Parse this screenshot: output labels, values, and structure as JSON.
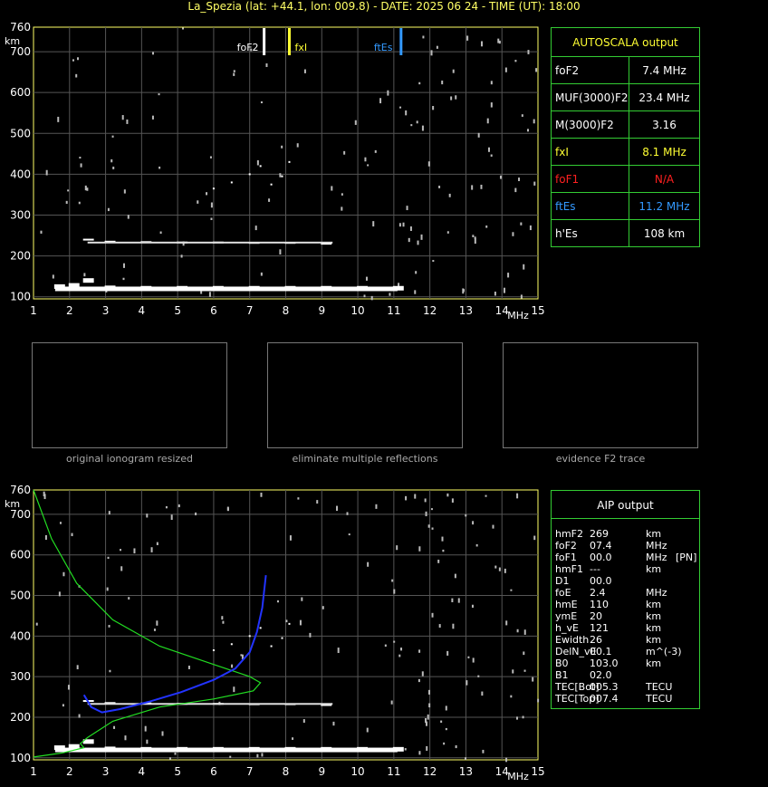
{
  "header": {
    "title": "La_Spezia (lat: +44.1, lon: 009.8) - DATE: 2025 06 24 - TIME (UT): 18:00"
  },
  "axes": {
    "y_unit": "km",
    "x_unit": "MHz",
    "x_ticks": [
      "1",
      "2",
      "3",
      "4",
      "5",
      "6",
      "7",
      "8",
      "9",
      "10",
      "11",
      "12",
      "13",
      "14",
      "15"
    ],
    "y_ticks": [
      "100",
      "200",
      "300",
      "400",
      "500",
      "600",
      "700",
      "760"
    ]
  },
  "markers": {
    "foF2": "foF2",
    "fxI": "fxI",
    "ftEs": "ftEs"
  },
  "autoscala": {
    "title": "AUTOSCALA output",
    "rows": [
      {
        "key": "foF2",
        "value": "7.4 MHz",
        "color": "#ffffff"
      },
      {
        "key": "MUF(3000)F2",
        "value": "23.4 MHz",
        "color": "#ffffff"
      },
      {
        "key": "M(3000)F2",
        "value": "3.16",
        "color": "#ffffff"
      },
      {
        "key": "fxI",
        "value": "8.1 MHz",
        "color": "#ffff33"
      },
      {
        "key": "foF1",
        "value": "N/A",
        "color": "#ff2020"
      },
      {
        "key": "ftEs",
        "value": "11.2 MHz",
        "color": "#3399ff"
      },
      {
        "key": "h'Es",
        "value": "108     km",
        "color": "#ffffff"
      }
    ]
  },
  "thumbs": {
    "captions": [
      "original ionogram resized",
      "eliminate multiple reflections",
      "evidence F2 trace"
    ]
  },
  "aip": {
    "title": "AIP output",
    "rows": [
      {
        "k": "hmF2",
        "v": "269",
        "u": "km",
        "x": ""
      },
      {
        "k": "foF2",
        "v": "07.4",
        "u": "MHz",
        "x": ""
      },
      {
        "k": "foF1",
        "v": "00.0",
        "u": "MHz",
        "x": "[PN]"
      },
      {
        "k": "hmF1",
        "v": "---",
        "u": "km",
        "x": ""
      },
      {
        "k": "D1",
        "v": "00.0",
        "u": "",
        "x": ""
      },
      {
        "k": "foE",
        "v": "2.4",
        "u": "MHz",
        "x": ""
      },
      {
        "k": "hmE",
        "v": "110",
        "u": "km",
        "x": ""
      },
      {
        "k": "ymE",
        "v": "20",
        "u": "km",
        "x": ""
      },
      {
        "k": "h_vE",
        "v": "121",
        "u": "km",
        "x": ""
      },
      {
        "k": "Ewidth",
        "v": "26",
        "u": "km",
        "x": ""
      },
      {
        "k": "DelN_vE",
        "v": "00.1",
        "u": "m^(-3)",
        "x": ""
      },
      {
        "k": "B0",
        "v": "103.0",
        "u": "km",
        "x": ""
      },
      {
        "k": "B1",
        "v": "02.0",
        "u": "",
        "x": ""
      },
      {
        "k": "TEC[Bot]",
        "v": "005.3",
        "u": "TECU",
        "x": ""
      },
      {
        "k": "TEC[Top]",
        "v": "007.4",
        "u": "TECU",
        "x": ""
      }
    ]
  },
  "chart_data": [
    {
      "type": "scatter",
      "xlabel": "MHz",
      "ylabel": "km",
      "xlim": [
        1,
        15
      ],
      "ylim": [
        95,
        760
      ],
      "series": [
        {
          "values": [
            [
              1.6,
              125
            ],
            [
              2.0,
              128
            ],
            [
              2.4,
              140
            ],
            [
              3,
              122
            ],
            [
              4,
              121
            ],
            [
              5,
              121
            ],
            [
              6,
              121
            ],
            [
              7,
              121
            ],
            [
              8,
              121
            ],
            [
              9,
              121
            ],
            [
              10,
              121
            ],
            [
              11,
              121
            ]
          ]
        },
        {
          "values": [
            [
              2.4,
              240
            ],
            [
              3,
              235
            ],
            [
              4,
              234
            ],
            [
              5,
              233
            ],
            [
              6,
              233
            ],
            [
              7,
              232
            ],
            [
              8,
              232
            ],
            [
              9,
              230
            ]
          ]
        },
        {
          "values": [
            [
              6.0,
              365
            ],
            [
              6.5,
              380
            ],
            [
              7.0,
              400
            ],
            [
              7.3,
              420
            ],
            [
              7.6,
              375
            ],
            [
              7.9,
              395
            ],
            [
              8.1,
              430
            ]
          ]
        }
      ]
    },
    {
      "type": "line",
      "xlabel": "MHz",
      "ylabel": "km",
      "xlim": [
        1,
        15
      ],
      "ylim": [
        95,
        760
      ],
      "series": [
        {
          "values": [
            [
              1,
              760
            ],
            [
              1.5,
              640
            ],
            [
              2.2,
              530
            ],
            [
              3.2,
              440
            ],
            [
              4.5,
              375
            ],
            [
              6,
              330
            ],
            [
              7.0,
              300
            ],
            [
              7.3,
              285
            ],
            [
              7.1,
              265
            ],
            [
              6,
              245
            ],
            [
              4.5,
              225
            ],
            [
              3.2,
              190
            ],
            [
              2.5,
              150
            ],
            [
              2.3,
              135
            ],
            [
              2.4,
              125
            ],
            [
              1.8,
              112
            ],
            [
              1,
              102
            ]
          ]
        },
        {
          "values": [
            [
              2.4,
              255
            ],
            [
              2.6,
              225
            ],
            [
              2.9,
              212
            ],
            [
              3.4,
              220
            ],
            [
              4.2,
              238
            ],
            [
              5.1,
              262
            ],
            [
              6.0,
              292
            ],
            [
              6.6,
              320
            ],
            [
              7.0,
              360
            ],
            [
              7.2,
              410
            ],
            [
              7.35,
              470
            ],
            [
              7.45,
              550
            ]
          ]
        }
      ]
    }
  ]
}
